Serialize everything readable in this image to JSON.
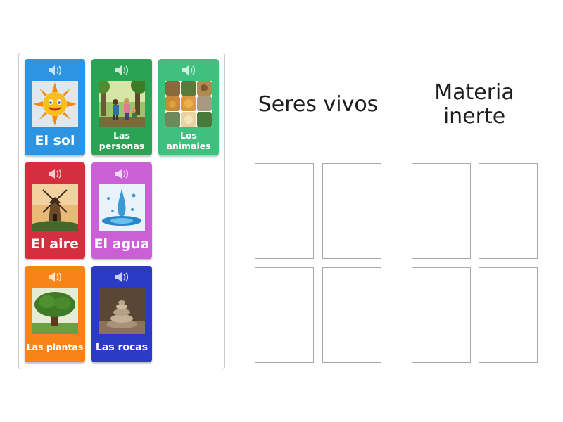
{
  "cards": {
    "sol": {
      "label": "El sol",
      "color": "#2b95e3",
      "icon": "speaker-icon"
    },
    "personas": {
      "label": "Las personas",
      "color": "#2aa354",
      "icon": "speaker-icon"
    },
    "animales": {
      "label": "Los animales",
      "color": "#3fc07f",
      "icon": "speaker-icon"
    },
    "aire": {
      "label": "El aire",
      "color": "#d42f3e",
      "icon": "speaker-icon"
    },
    "agua": {
      "label": "El agua",
      "color": "#ca5fd6",
      "icon": "speaker-icon"
    },
    "plantas": {
      "label": "Las plantas",
      "color": "#f78419",
      "icon": "speaker-icon"
    },
    "rocas": {
      "label": "Las rocas",
      "color": "#2c3bc3",
      "icon": "speaker-icon"
    }
  },
  "columns": {
    "vivos": {
      "title": "Seres vivos"
    },
    "inerte": {
      "title": "Materia inerte"
    }
  }
}
